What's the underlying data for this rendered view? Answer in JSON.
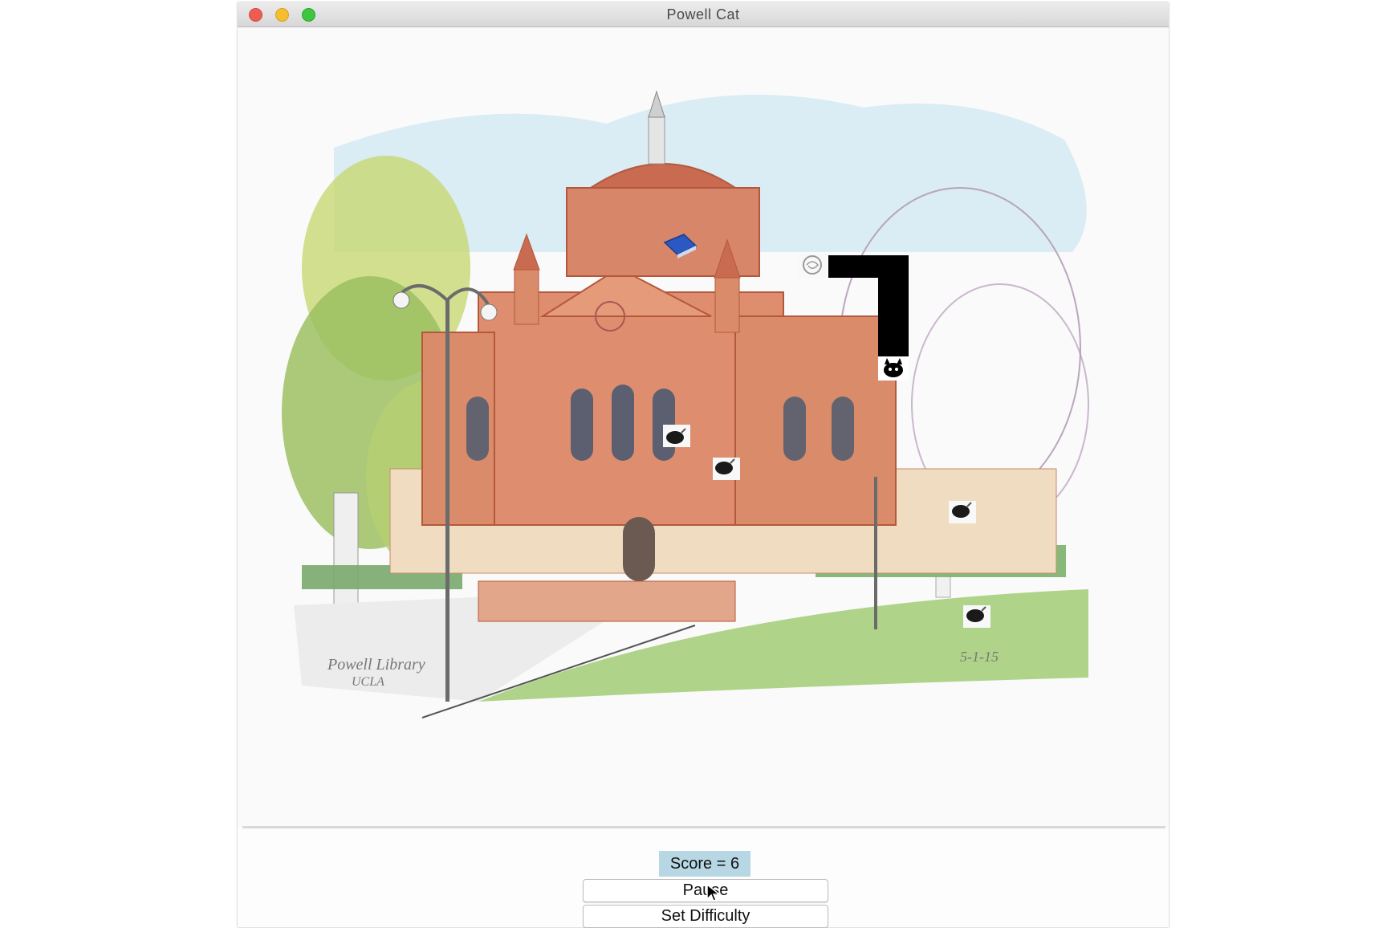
{
  "window": {
    "title": "Powell Cat"
  },
  "score": {
    "label": "Score = 6",
    "value": 6
  },
  "buttons": {
    "pause": "Pause",
    "set_difficulty": "Set Difficulty"
  },
  "artwork": {
    "caption": "Powell Library\nUCLA",
    "signature": "5-1-15"
  },
  "game": {
    "items": [
      "book-icon",
      "yarn-icon",
      "bomb-icon",
      "bomb-icon",
      "bomb-icon",
      "bomb-icon"
    ],
    "player": "cat-head-icon"
  },
  "colors": {
    "score_bg": "#b6d7e3",
    "snake": "#000000",
    "book": "#2b59c3"
  }
}
